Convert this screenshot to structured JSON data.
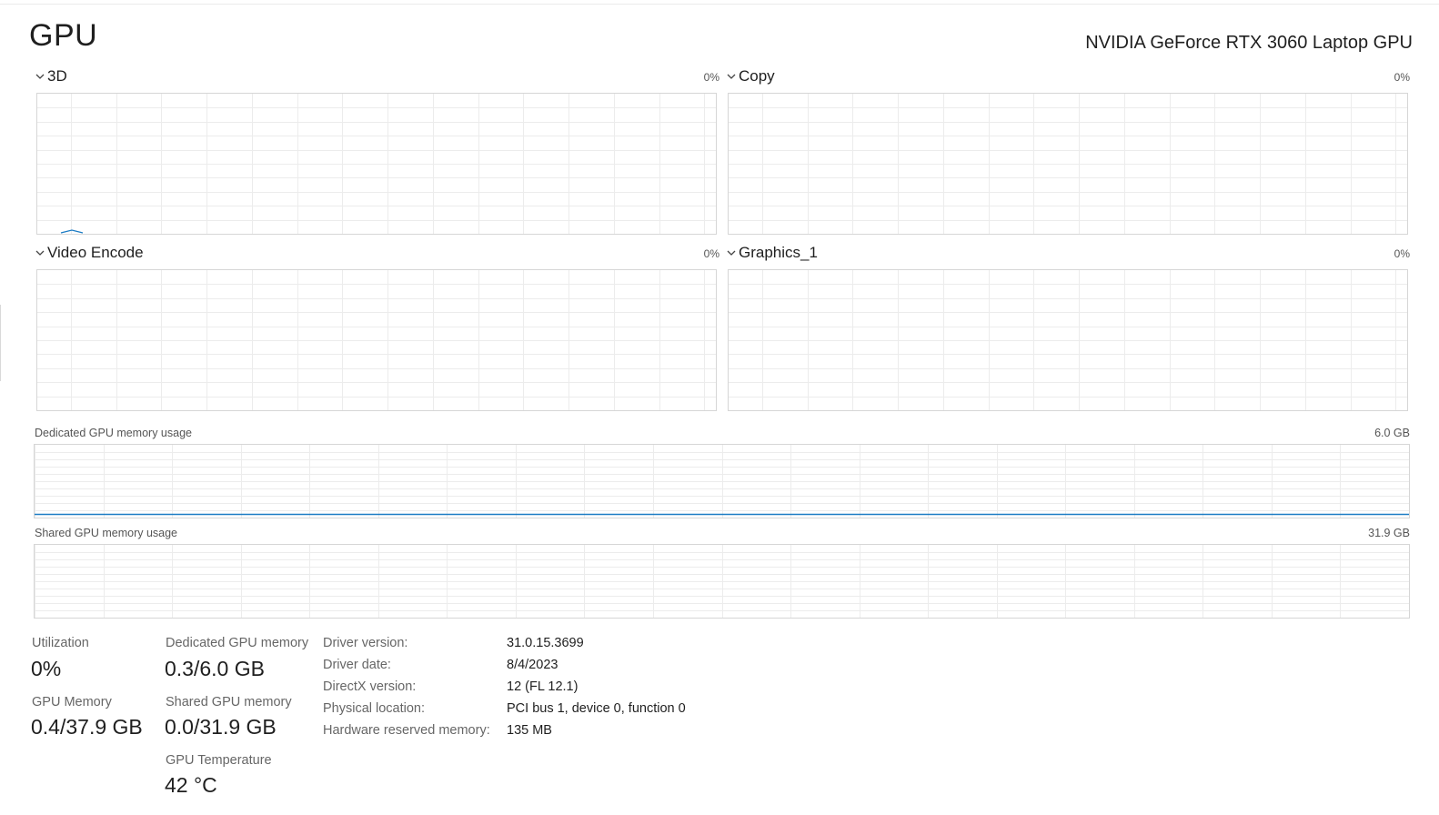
{
  "header": {
    "title": "GPU",
    "gpu_name": "NVIDIA GeForce RTX 3060 Laptop GPU"
  },
  "engines": [
    {
      "name": "3D",
      "percent": "0%"
    },
    {
      "name": "Copy",
      "percent": "0%"
    },
    {
      "name": "Video Encode",
      "percent": "0%"
    },
    {
      "name": "Graphics_1",
      "percent": "0%"
    }
  ],
  "memory_graphs": {
    "dedicated": {
      "label": "Dedicated GPU memory usage",
      "max": "6.0 GB"
    },
    "shared": {
      "label": "Shared GPU memory usage",
      "max": "31.9 GB"
    }
  },
  "stats": {
    "utilization": {
      "label": "Utilization",
      "value": "0%"
    },
    "dedicated_memory": {
      "label": "Dedicated GPU memory",
      "value": "0.3/6.0 GB"
    },
    "gpu_memory": {
      "label": "GPU Memory",
      "value": "0.4/37.9 GB"
    },
    "shared_memory": {
      "label": "Shared GPU memory",
      "value": "0.0/31.9 GB"
    },
    "temperature": {
      "label": "GPU Temperature",
      "value": "42 °C"
    }
  },
  "properties": [
    {
      "label": "Driver version:",
      "value": "31.0.15.3699"
    },
    {
      "label": "Driver date:",
      "value": "8/4/2023"
    },
    {
      "label": "DirectX version:",
      "value": "12 (FL 12.1)"
    },
    {
      "label": "Physical location:",
      "value": "PCI bus 1, device 0, function 0"
    },
    {
      "label": "Hardware reserved memory:",
      "value": "135 MB"
    }
  ],
  "colors": {
    "accent": "#1c7cc4",
    "grid": "#ececec",
    "border": "#d6d6d6"
  }
}
